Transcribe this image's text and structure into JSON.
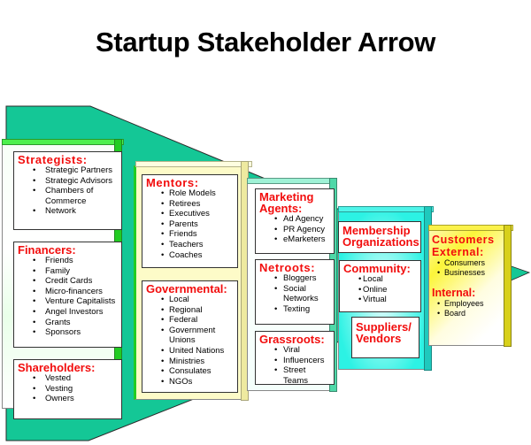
{
  "title": "Startup Stakeholder Arrow",
  "colors": {
    "arrow_fill": "#14c796",
    "heading_red": "#f20d0d",
    "panel1_green": "#33e033",
    "panel2_yellow": "#fdfbc8",
    "panel3_teal": "#5ee0b2",
    "panel4_cyan": "#28f2e6",
    "panel5_yellow": "#fcf53a"
  },
  "stages": [
    {
      "name": "stage-1",
      "groups": [
        {
          "heading": "Strategists:",
          "items": [
            "Strategic Partners",
            "Strategic Advisors",
            "Chambers of",
            "Commerce",
            "Network"
          ]
        },
        {
          "heading": "Financers:",
          "items": [
            "Friends",
            "Family",
            "Credit Cards",
            "Micro-financers",
            "Venture Capitalists",
            "Angel Investors",
            "Grants",
            "Sponsors"
          ]
        },
        {
          "heading": "Shareholders:",
          "items": [
            "Vested",
            "Vesting",
            "Owners"
          ]
        }
      ]
    },
    {
      "name": "stage-2",
      "groups": [
        {
          "heading": "Mentors:",
          "items": [
            "Role Models",
            "Retirees",
            "Executives",
            "Parents",
            "Friends",
            "Teachers",
            "Coaches"
          ]
        },
        {
          "heading": "Governmental:",
          "items": [
            "Local",
            "Regional",
            "Federal",
            "Government",
            "Unions",
            "United Nations",
            "Ministries",
            "Consulates",
            "NGOs"
          ]
        }
      ]
    },
    {
      "name": "stage-3",
      "groups": [
        {
          "heading": "Marketing Agents:",
          "heading_lines": [
            "Marketing",
            "Agents:"
          ],
          "items": [
            "Ad Agency",
            "PR Agency",
            "eMarketers"
          ]
        },
        {
          "heading": "Netroots:",
          "items": [
            "Bloggers",
            "Social",
            "Networks",
            "Texting"
          ]
        },
        {
          "heading": "Grassroots:",
          "items": [
            "Viral",
            "Influencers",
            "Street Teams"
          ]
        }
      ]
    },
    {
      "name": "stage-4",
      "groups": [
        {
          "heading": "Membership Organizations",
          "heading_lines": [
            "Membership",
            "Organizations"
          ],
          "items": []
        },
        {
          "heading": "Community:",
          "items": [
            "Local",
            "Online",
            "Virtual"
          ]
        },
        {
          "heading": "Suppliers/ Vendors",
          "heading_lines": [
            "Suppliers/",
            "Vendors"
          ],
          "items": []
        }
      ]
    },
    {
      "name": "stage-5",
      "groups": [
        {
          "heading": "Customers",
          "items": []
        },
        {
          "heading": "External:",
          "items": [
            "Consumers",
            "Businesses"
          ]
        },
        {
          "heading": "Internal:",
          "items": [
            "Employees",
            "Board"
          ]
        }
      ]
    }
  ]
}
